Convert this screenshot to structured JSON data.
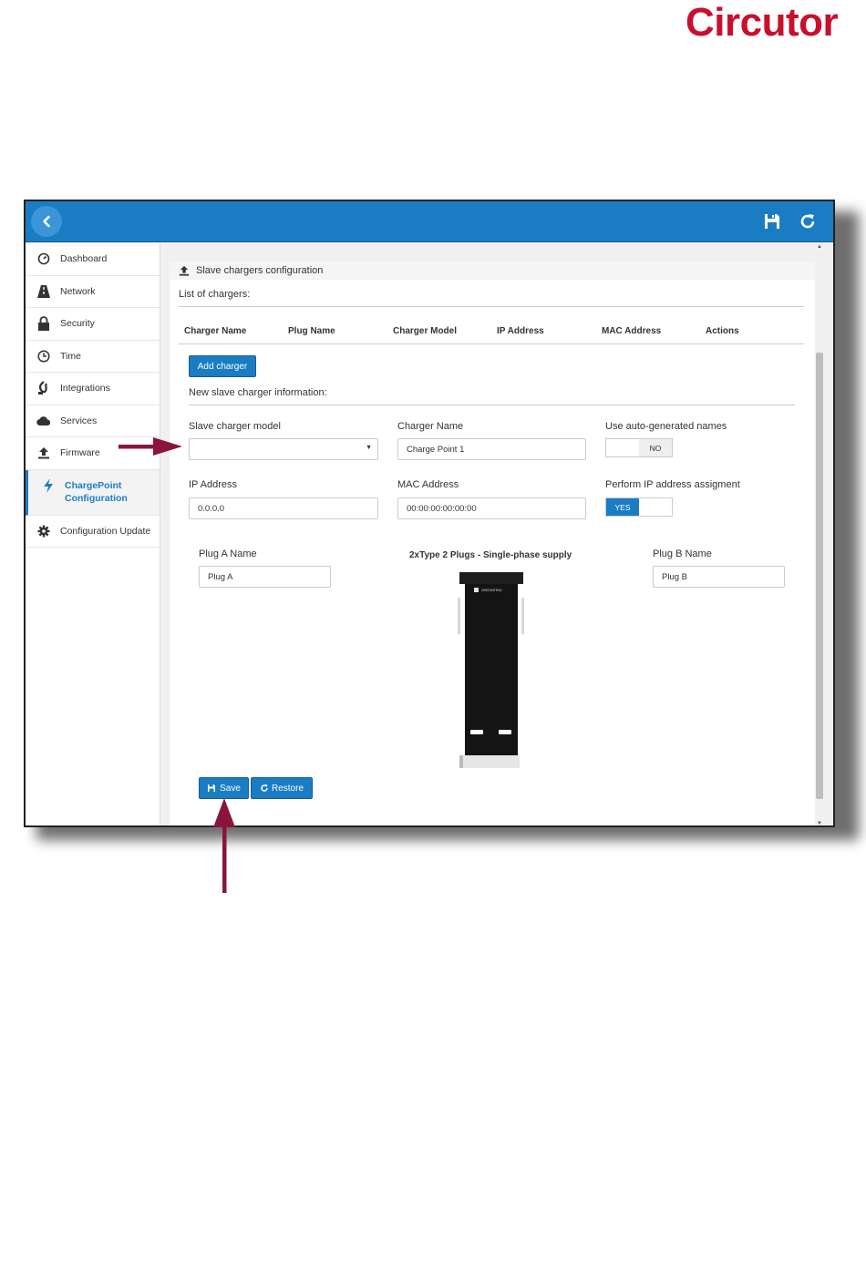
{
  "brand": {
    "logo_text": "Circutor",
    "logo_color": "#c8102e"
  },
  "topbar": {
    "back_icon": "chevron-left-icon",
    "save_icon": "floppy-disk-icon",
    "refresh_icon": "refresh-icon"
  },
  "sidebar": {
    "items": [
      {
        "label": "Dashboard",
        "icon": "speedometer-icon"
      },
      {
        "label": "Network",
        "icon": "road-icon"
      },
      {
        "label": "Security",
        "icon": "lock-icon"
      },
      {
        "label": "Time",
        "icon": "clock-icon"
      },
      {
        "label": "Integrations",
        "icon": "integrations-icon"
      },
      {
        "label": "Services",
        "icon": "cloud-icon"
      },
      {
        "label": "Firmware",
        "icon": "upload-icon"
      },
      {
        "label": "ChargePoint Configuration",
        "icon": "bolt-icon",
        "active": true
      },
      {
        "label": "Configuration Update",
        "icon": "gear-icon"
      }
    ]
  },
  "panel": {
    "title": "Slave chargers configuration",
    "list_label": "List of chargers:",
    "table_headers": [
      "Charger Name",
      "Plug Name",
      "Charger Model",
      "IP Address",
      "MAC Address",
      "Actions"
    ],
    "add_button": "Add charger",
    "new_section": "New slave charger information:",
    "fields": {
      "model_label": "Slave charger model",
      "model_value": "",
      "name_label": "Charger Name",
      "name_value": "Charge Point 1",
      "auto_names_label": "Use auto-generated names",
      "auto_names_value": "NO",
      "ip_label": "IP Address",
      "ip_value": "0.0.0.0",
      "mac_label": "MAC Address",
      "mac_value": "00:00:00:00:00:00",
      "ip_assign_label": "Perform IP address assigment",
      "ip_assign_value": "YES",
      "plug_a_label": "Plug A Name",
      "plug_a_value": "Plug A",
      "plug_b_label": "Plug B Name",
      "plug_b_value": "Plug B",
      "device_caption": "2xType 2 Plugs - Single-phase supply",
      "device_brand": "CIRCONTROL"
    },
    "save_button": "Save",
    "restore_button": "Restore"
  },
  "colors": {
    "primary": "#1a7dc4",
    "arrow": "#8b1538"
  }
}
